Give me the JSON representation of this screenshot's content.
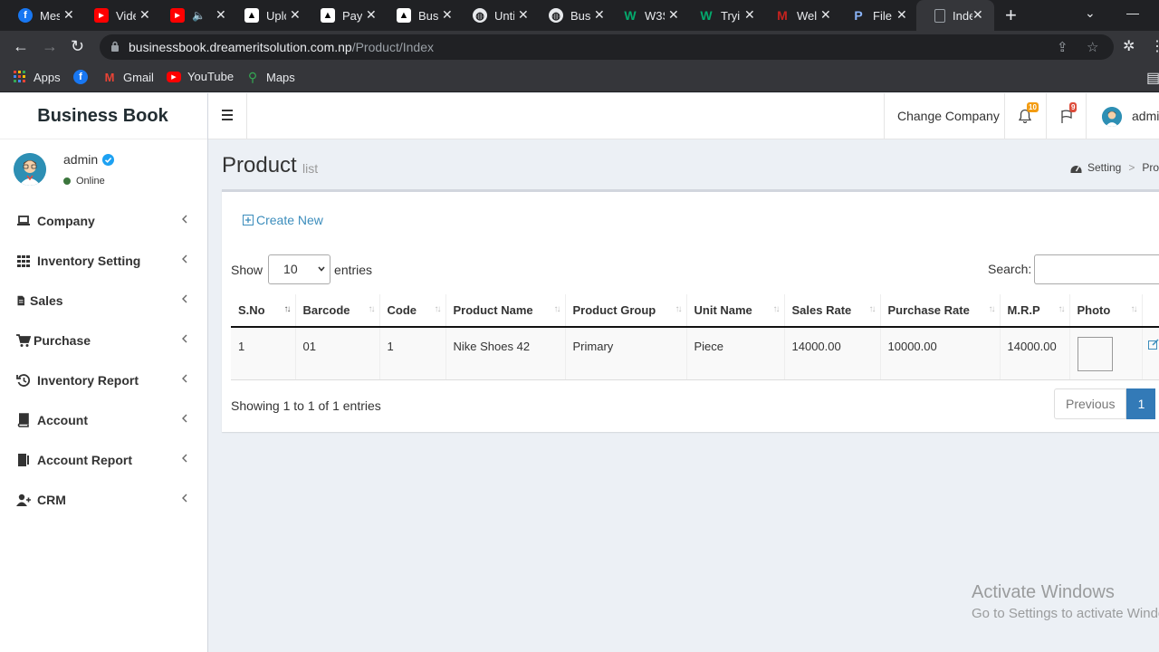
{
  "browser": {
    "tabs": [
      {
        "title": "Mes",
        "icon": "facebook-icon",
        "color": "#1877f2",
        "glyph": "f"
      },
      {
        "title": "Vide",
        "icon": "youtube-icon",
        "color": "#ff0000",
        "glyph": "▶"
      },
      {
        "title": "",
        "icon": "youtube-icon",
        "color": "#ff0000",
        "glyph": "▶"
      },
      {
        "title": "Uplo",
        "icon": "document-icon",
        "color": "#ffffff",
        "glyph": ""
      },
      {
        "title": "Pay",
        "icon": "document-icon",
        "color": "#ffffff",
        "glyph": ""
      },
      {
        "title": "Busi",
        "icon": "document-icon",
        "color": "#ffffff",
        "glyph": ""
      },
      {
        "title": "Unti",
        "icon": "globe-icon",
        "color": "#e8eaed",
        "glyph": ""
      },
      {
        "title": "Busi",
        "icon": "globe-icon",
        "color": "#e8eaed",
        "glyph": ""
      },
      {
        "title": "W3S",
        "icon": "w3schools-icon",
        "color": "#04aa6d",
        "glyph": "W"
      },
      {
        "title": "Tryi",
        "icon": "w3schools-icon",
        "color": "#04aa6d",
        "glyph": "W"
      },
      {
        "title": "Wel",
        "icon": "gmail-icon",
        "color": "#c5221f",
        "glyph": "M"
      },
      {
        "title": "File",
        "icon": "paypal-icon",
        "color": "#253b80",
        "glyph": "P"
      },
      {
        "title": "Inde",
        "icon": "page-icon",
        "color": "#8ab4f8",
        "glyph": ""
      }
    ],
    "url_host": "businessbook.dreameritsolution.com.np",
    "url_path": "/Product/Index",
    "bookmarks": [
      {
        "label": "Apps",
        "icon": "apps-grid-icon"
      },
      {
        "label": "",
        "icon": "facebook-icon"
      },
      {
        "label": "Gmail",
        "icon": "gmail-icon"
      },
      {
        "label": "YouTube",
        "icon": "youtube-icon"
      },
      {
        "label": "Maps",
        "icon": "maps-icon"
      }
    ]
  },
  "app": {
    "brand": "Business Book",
    "user": {
      "name": "admin",
      "status": "Online"
    },
    "menu": [
      {
        "label": "Company",
        "icon": "laptop-icon"
      },
      {
        "label": "Inventory Setting",
        "icon": "th-icon"
      },
      {
        "label": "Sales",
        "icon": "file-invoice-icon"
      },
      {
        "label": "Purchase",
        "icon": "cart-icon"
      },
      {
        "label": "Inventory Report",
        "icon": "history-icon"
      },
      {
        "label": "Account",
        "icon": "book-icon"
      },
      {
        "label": "Account Report",
        "icon": "book-report-icon"
      },
      {
        "label": "CRM",
        "icon": "user-plus-icon"
      }
    ],
    "topnav": {
      "change_company": "Change Company",
      "notif_count": "10",
      "flag_count": "9",
      "user_label": "admin"
    },
    "page": {
      "title": "Product",
      "subtitle": "list",
      "breadcrumb": [
        "Setting",
        "Prod"
      ]
    },
    "box": {
      "create_new": "Create New",
      "show_label": "Show",
      "entries_value": "10",
      "entries_label": "entries",
      "search_label": "Search:",
      "info": "Showing 1 to 1 of 1 entries",
      "prev": "Previous",
      "page": "1"
    },
    "table": {
      "columns": [
        "S.No",
        "Barcode",
        "Code",
        "Product Name",
        "Product Group",
        "Unit Name",
        "Sales Rate",
        "Purchase Rate",
        "M.R.P",
        "Photo"
      ],
      "rows": [
        [
          "1",
          "01",
          "1",
          "Nike Shoes 42",
          "Primary",
          "Piece",
          "14000.00",
          "10000.00",
          "14000.00"
        ]
      ]
    },
    "watermark": {
      "line1": "Activate Windows",
      "line2": "Go to Settings to activate Windows."
    }
  }
}
